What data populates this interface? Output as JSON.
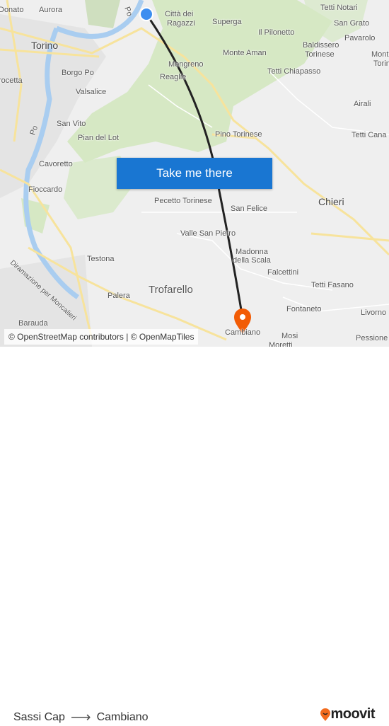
{
  "map": {
    "labels": [
      {
        "text": "Donato"
      },
      {
        "text": "Aurora"
      },
      {
        "text": "Po"
      },
      {
        "text": "Città dei"
      },
      {
        "text": "Ragazzi"
      },
      {
        "text": "Superga"
      },
      {
        "text": "Tetti Notari"
      },
      {
        "text": "San Grato"
      },
      {
        "text": "Pavarolo"
      },
      {
        "text": "Il Pilonetto"
      },
      {
        "text": "Baldissero"
      },
      {
        "text": "Torinese"
      },
      {
        "text": "Monte"
      },
      {
        "text": "Torin"
      },
      {
        "text": "Torino"
      },
      {
        "text": "Monte Aman"
      },
      {
        "text": "Mongreno"
      },
      {
        "text": "Tetti Chiapasso"
      },
      {
        "text": "Borgo Po"
      },
      {
        "text": "Reaglie"
      },
      {
        "text": "rocetta"
      },
      {
        "text": "Valsalice"
      },
      {
        "text": "Airali"
      },
      {
        "text": "San Vito"
      },
      {
        "text": "Pian del Lot"
      },
      {
        "text": "Pino Torinese"
      },
      {
        "text": "Tetti Cana"
      },
      {
        "text": "Po"
      },
      {
        "text": "Cavoretto"
      },
      {
        "text": "Fioccardo"
      },
      {
        "text": "Chieri"
      },
      {
        "text": "Pecetto Torinese"
      },
      {
        "text": "San Felice"
      },
      {
        "text": "Valle San Pietro"
      },
      {
        "text": "Madonna"
      },
      {
        "text": "della Scala"
      },
      {
        "text": "Testona"
      },
      {
        "text": "Diramazione per Moncalieri"
      },
      {
        "text": "Falcettini"
      },
      {
        "text": "Trofarello"
      },
      {
        "text": "Palera"
      },
      {
        "text": "Tetti Fasano"
      },
      {
        "text": "Fontaneto"
      },
      {
        "text": "Livorno"
      },
      {
        "text": "Barauda"
      },
      {
        "text": "Cambiano"
      },
      {
        "text": "Mosi"
      },
      {
        "text": "Pessione"
      },
      {
        "text": "Moretti"
      }
    ],
    "cta_label": "Take me there",
    "attribution": "© OpenStreetMap contributors | © OpenMapTiles",
    "colors": {
      "route": "#222222",
      "origin": "#3d8ef0",
      "destination": "#f25c05",
      "button": "#1976d2"
    }
  },
  "trip": {
    "origin": "Sassi Cap",
    "arrow": "⟶",
    "destination": "Cambiano"
  },
  "brand": {
    "name": "moovit",
    "color": "#f26b1d"
  }
}
